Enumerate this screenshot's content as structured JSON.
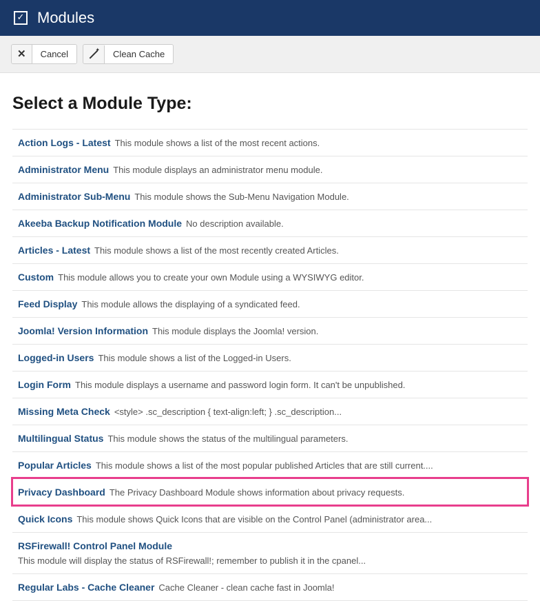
{
  "header": {
    "title": "Modules"
  },
  "toolbar": {
    "cancel_label": "Cancel",
    "clean_cache_label": "Clean Cache"
  },
  "page": {
    "heading": "Select a Module Type:"
  },
  "modules": [
    {
      "name": "Action Logs - Latest",
      "desc": "This module shows a list of the most recent actions.",
      "highlighted": false
    },
    {
      "name": "Administrator Menu",
      "desc": "This module displays an administrator menu module.",
      "highlighted": false
    },
    {
      "name": "Administrator Sub-Menu",
      "desc": "This module shows the Sub-Menu Navigation Module.",
      "highlighted": false
    },
    {
      "name": "Akeeba Backup Notification Module",
      "desc": "No description available.",
      "highlighted": false
    },
    {
      "name": "Articles - Latest",
      "desc": "This module shows a list of the most recently created Articles.",
      "highlighted": false
    },
    {
      "name": "Custom",
      "desc": "This module allows you to create your own Module using a WYSIWYG editor.",
      "highlighted": false
    },
    {
      "name": "Feed Display",
      "desc": "This module allows the displaying of a syndicated feed.",
      "highlighted": false
    },
    {
      "name": "Joomla! Version Information",
      "desc": "This module displays the Joomla! version.",
      "highlighted": false
    },
    {
      "name": "Logged-in Users",
      "desc": "This module shows a list of the Logged-in Users.",
      "highlighted": false
    },
    {
      "name": "Login Form",
      "desc": "This module displays a username and password login form. It can't be unpublished.",
      "highlighted": false
    },
    {
      "name": "Missing Meta Check",
      "desc": "<style> .sc_description { text-align:left; } .sc_description...",
      "highlighted": false
    },
    {
      "name": "Multilingual Status",
      "desc": "This module shows the status of the multilingual parameters.",
      "highlighted": false
    },
    {
      "name": "Popular Articles",
      "desc": "This module shows a list of the most popular published Articles that are still current....",
      "highlighted": false
    },
    {
      "name": "Privacy Dashboard",
      "desc": "The Privacy Dashboard Module shows information about privacy requests.",
      "highlighted": true
    },
    {
      "name": "Quick Icons",
      "desc": "This module shows Quick Icons that are visible on the Control Panel (administrator area...",
      "highlighted": false
    },
    {
      "name": "RSFirewall! Control Panel Module",
      "desc": "This module will display the status of RSFirewall!; remember to publish it in the cpanel...",
      "highlighted": false
    },
    {
      "name": "Regular Labs - Cache Cleaner",
      "desc": "Cache Cleaner - clean cache fast in Joomla!",
      "highlighted": false
    }
  ]
}
